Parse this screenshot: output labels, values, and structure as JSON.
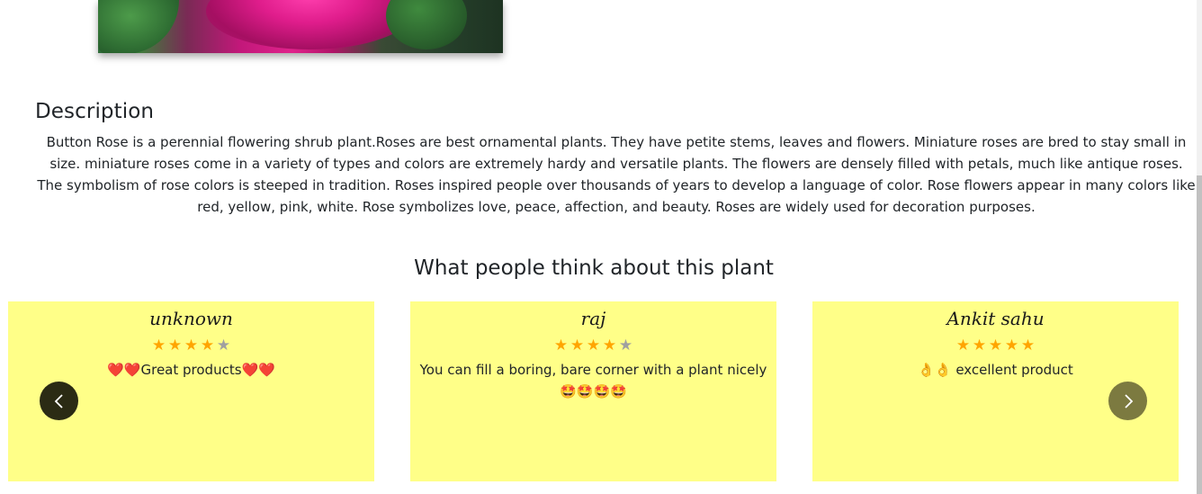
{
  "product": {
    "image_alt": "Button Rose"
  },
  "description": {
    "heading": "Description",
    "text": "Button Rose is a perennial flowering shrub plant.Roses are best ornamental plants. They have petite stems, leaves and flowers. Miniature roses are bred to stay small in size. miniature roses come in a variety of types and colors are extremely hardy and versatile plants. The flowers are densely filled with petals, much like antique roses. The symbolism of rose colors is steeped in tradition. Roses inspired people over thousands of years to develop a language of color. Rose flowers appear in many colors like red, yellow, pink, white. Rose symbolizes love, peace, affection, and beauty. Roses are widely used for decoration purposes."
  },
  "reviews": {
    "heading": "What people think about this plant",
    "card_color": "#ffff88",
    "star_color": "#ffa500",
    "items": [
      {
        "name": "unknown",
        "rating": 4,
        "max": 5,
        "text": "❤️❤️Great products❤️❤️"
      },
      {
        "name": "raj",
        "rating": 4,
        "max": 5,
        "text": "You can fill a boring, bare corner with a plant nicely🤩🤩🤩🤩"
      },
      {
        "name": "Ankit sahu",
        "rating": 5,
        "max": 5,
        "text": "👌👌 excellent product"
      }
    ],
    "prev_icon": "chevron-left-icon",
    "next_icon": "chevron-right-icon"
  }
}
